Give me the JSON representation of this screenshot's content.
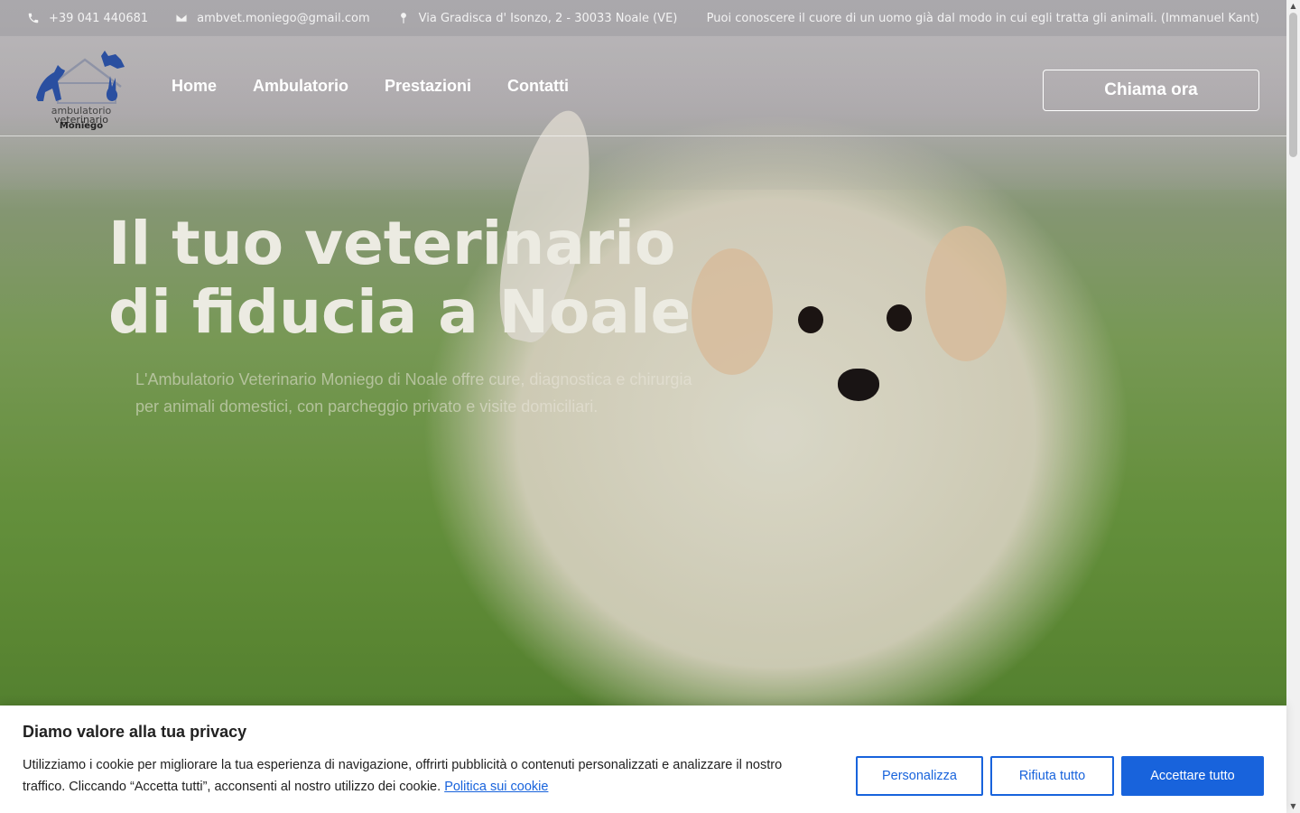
{
  "topbar": {
    "phone": "+39 041 440681",
    "email": "ambvet.moniego@gmail.com",
    "address": "Via Gradisca d' Isonzo, 2 - 30033 Noale (VE)",
    "quote": "Puoi conoscere il cuore di un uomo già dal modo in cui egli tratta gli animali. (Immanuel Kant)"
  },
  "logo": {
    "line1": "ambulatorio",
    "line2": "veterinario",
    "line3": "Moniego"
  },
  "nav": {
    "items": [
      "Home",
      "Ambulatorio",
      "Prestazioni",
      "Contatti"
    ],
    "cta": "Chiama ora"
  },
  "hero": {
    "title": "Il tuo veterinario di fiducia a Noale",
    "subtitle": "L'Ambulatorio Veterinario Moniego di Noale offre cure, diagnostica e chirurgia per animali domestici, con parcheggio privato e visite domiciliari."
  },
  "cookie": {
    "title": "Diamo valore alla tua privacy",
    "text": "Utilizziamo i cookie per migliorare la tua esperienza di navigazione, offrirti pubblicità o contenuti personalizzati e analizzare il nostro traffico. Cliccando “Accetta tutti”, acconsenti al nostro utilizzo dei cookie.",
    "link": "Politica sui cookie",
    "btn_customize": "Personalizza",
    "btn_reject": "Rifiuta tutto",
    "btn_accept": "Accettare tutto"
  },
  "colors": {
    "accent": "#1863dc",
    "logo_blue": "#2a4fa0"
  },
  "icons": {
    "phone": "phone-icon",
    "email": "envelope-icon",
    "address": "map-pin-icon"
  }
}
